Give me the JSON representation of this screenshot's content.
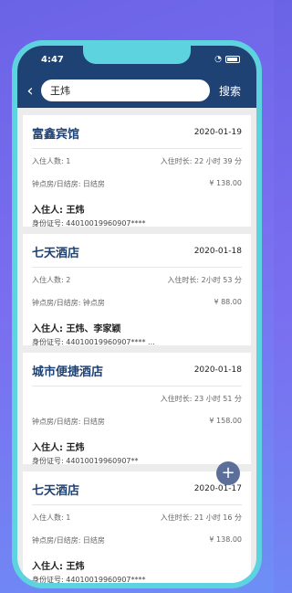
{
  "status": {
    "time": "4:47"
  },
  "nav": {
    "search_value": "王炜",
    "search_button": "搜索"
  },
  "records": [
    {
      "hotel": "富鑫宾馆",
      "date": "2020-01-19",
      "guests_label": "入住人数: 1",
      "duration_label": "入住时长: 22 小时 39 分",
      "room_type": "钟点房/日结房: 日结房",
      "price": "¥ 138.00",
      "guest": "入住人: 王炜",
      "id": "身份证号: 44010019960907****"
    },
    {
      "hotel": "七天酒店",
      "date": "2020-01-18",
      "guests_label": "入住人数: 2",
      "duration_label": "入住时长: 2小时 53 分",
      "room_type": "钟点房/日结房: 钟点房",
      "price": "¥ 88.00",
      "guest": "入住人: 王炜、李家颖",
      "id": "身份证号: 44010019960907****   ..."
    },
    {
      "hotel": "城市便捷酒店",
      "date": "2020-01-18",
      "guests_label": "",
      "duration_label": "入住时长: 23 小时 51 分",
      "room_type": "钟点房/日结房: 日结房",
      "price": "¥ 158.00",
      "guest": "入住人: 王炜",
      "id": "身份证号: 44010019960907**"
    },
    {
      "hotel": "七天酒店",
      "date": "2020-01-17",
      "guests_label": "入住人数: 1",
      "duration_label": "入住时长: 21 小时 16 分",
      "room_type": "钟点房/日结房: 日结房",
      "price": "¥ 138.00",
      "guest": "入住人: 王炜",
      "id": "身份证号: 44010019960907****"
    }
  ],
  "fab": {
    "label": "+"
  }
}
